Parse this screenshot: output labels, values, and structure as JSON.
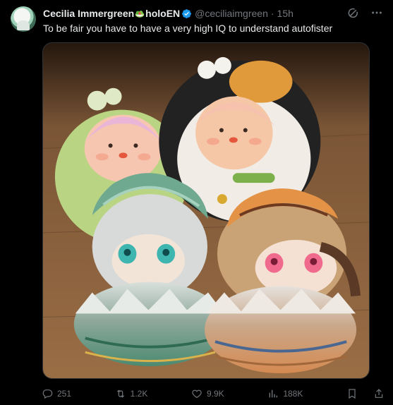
{
  "post": {
    "display_name": "Cecilia Immergreen",
    "name_suffix": "holoEN",
    "handle": "@ceciliaimgreen",
    "separator": "·",
    "time": "15h",
    "text": "To be fair you have to have a very high IQ to understand autofister"
  },
  "actions": {
    "replies": "251",
    "reposts": "1.2K",
    "likes": "9.9K",
    "views": "188K"
  },
  "icons": {
    "avatar": "profile-avatar",
    "salad": "green-salad-emoji",
    "verified": "verified-badge-icon",
    "grok": "grok-icon",
    "more": "more-dots-icon",
    "reply": "reply-icon",
    "repost": "repost-icon",
    "like": "heart-icon",
    "views": "analytics-icon",
    "bookmark": "bookmark-icon",
    "share": "share-icon"
  },
  "colors": {
    "background": "#000000",
    "text": "#e7e9ea",
    "muted": "#71767b",
    "verified": "#1d9bf0"
  }
}
